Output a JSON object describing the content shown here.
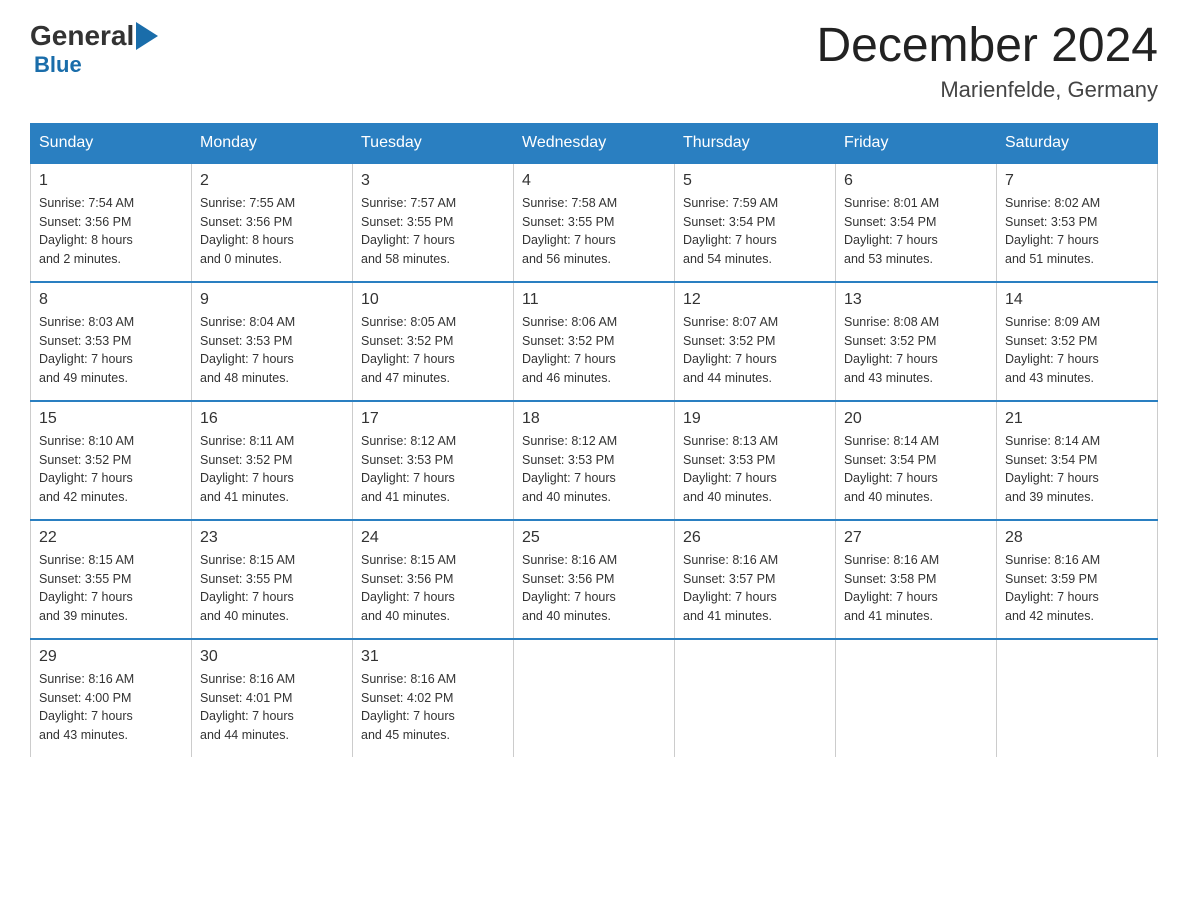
{
  "logo": {
    "general": "General",
    "arrow": "▶",
    "blue": "Blue"
  },
  "title": "December 2024",
  "location": "Marienfelde, Germany",
  "days_header": [
    "Sunday",
    "Monday",
    "Tuesday",
    "Wednesday",
    "Thursday",
    "Friday",
    "Saturday"
  ],
  "weeks": [
    [
      {
        "day": "1",
        "info": "Sunrise: 7:54 AM\nSunset: 3:56 PM\nDaylight: 8 hours\nand 2 minutes."
      },
      {
        "day": "2",
        "info": "Sunrise: 7:55 AM\nSunset: 3:56 PM\nDaylight: 8 hours\nand 0 minutes."
      },
      {
        "day": "3",
        "info": "Sunrise: 7:57 AM\nSunset: 3:55 PM\nDaylight: 7 hours\nand 58 minutes."
      },
      {
        "day": "4",
        "info": "Sunrise: 7:58 AM\nSunset: 3:55 PM\nDaylight: 7 hours\nand 56 minutes."
      },
      {
        "day": "5",
        "info": "Sunrise: 7:59 AM\nSunset: 3:54 PM\nDaylight: 7 hours\nand 54 minutes."
      },
      {
        "day": "6",
        "info": "Sunrise: 8:01 AM\nSunset: 3:54 PM\nDaylight: 7 hours\nand 53 minutes."
      },
      {
        "day": "7",
        "info": "Sunrise: 8:02 AM\nSunset: 3:53 PM\nDaylight: 7 hours\nand 51 minutes."
      }
    ],
    [
      {
        "day": "8",
        "info": "Sunrise: 8:03 AM\nSunset: 3:53 PM\nDaylight: 7 hours\nand 49 minutes."
      },
      {
        "day": "9",
        "info": "Sunrise: 8:04 AM\nSunset: 3:53 PM\nDaylight: 7 hours\nand 48 minutes."
      },
      {
        "day": "10",
        "info": "Sunrise: 8:05 AM\nSunset: 3:52 PM\nDaylight: 7 hours\nand 47 minutes."
      },
      {
        "day": "11",
        "info": "Sunrise: 8:06 AM\nSunset: 3:52 PM\nDaylight: 7 hours\nand 46 minutes."
      },
      {
        "day": "12",
        "info": "Sunrise: 8:07 AM\nSunset: 3:52 PM\nDaylight: 7 hours\nand 44 minutes."
      },
      {
        "day": "13",
        "info": "Sunrise: 8:08 AM\nSunset: 3:52 PM\nDaylight: 7 hours\nand 43 minutes."
      },
      {
        "day": "14",
        "info": "Sunrise: 8:09 AM\nSunset: 3:52 PM\nDaylight: 7 hours\nand 43 minutes."
      }
    ],
    [
      {
        "day": "15",
        "info": "Sunrise: 8:10 AM\nSunset: 3:52 PM\nDaylight: 7 hours\nand 42 minutes."
      },
      {
        "day": "16",
        "info": "Sunrise: 8:11 AM\nSunset: 3:52 PM\nDaylight: 7 hours\nand 41 minutes."
      },
      {
        "day": "17",
        "info": "Sunrise: 8:12 AM\nSunset: 3:53 PM\nDaylight: 7 hours\nand 41 minutes."
      },
      {
        "day": "18",
        "info": "Sunrise: 8:12 AM\nSunset: 3:53 PM\nDaylight: 7 hours\nand 40 minutes."
      },
      {
        "day": "19",
        "info": "Sunrise: 8:13 AM\nSunset: 3:53 PM\nDaylight: 7 hours\nand 40 minutes."
      },
      {
        "day": "20",
        "info": "Sunrise: 8:14 AM\nSunset: 3:54 PM\nDaylight: 7 hours\nand 40 minutes."
      },
      {
        "day": "21",
        "info": "Sunrise: 8:14 AM\nSunset: 3:54 PM\nDaylight: 7 hours\nand 39 minutes."
      }
    ],
    [
      {
        "day": "22",
        "info": "Sunrise: 8:15 AM\nSunset: 3:55 PM\nDaylight: 7 hours\nand 39 minutes."
      },
      {
        "day": "23",
        "info": "Sunrise: 8:15 AM\nSunset: 3:55 PM\nDaylight: 7 hours\nand 40 minutes."
      },
      {
        "day": "24",
        "info": "Sunrise: 8:15 AM\nSunset: 3:56 PM\nDaylight: 7 hours\nand 40 minutes."
      },
      {
        "day": "25",
        "info": "Sunrise: 8:16 AM\nSunset: 3:56 PM\nDaylight: 7 hours\nand 40 minutes."
      },
      {
        "day": "26",
        "info": "Sunrise: 8:16 AM\nSunset: 3:57 PM\nDaylight: 7 hours\nand 41 minutes."
      },
      {
        "day": "27",
        "info": "Sunrise: 8:16 AM\nSunset: 3:58 PM\nDaylight: 7 hours\nand 41 minutes."
      },
      {
        "day": "28",
        "info": "Sunrise: 8:16 AM\nSunset: 3:59 PM\nDaylight: 7 hours\nand 42 minutes."
      }
    ],
    [
      {
        "day": "29",
        "info": "Sunrise: 8:16 AM\nSunset: 4:00 PM\nDaylight: 7 hours\nand 43 minutes."
      },
      {
        "day": "30",
        "info": "Sunrise: 8:16 AM\nSunset: 4:01 PM\nDaylight: 7 hours\nand 44 minutes."
      },
      {
        "day": "31",
        "info": "Sunrise: 8:16 AM\nSunset: 4:02 PM\nDaylight: 7 hours\nand 45 minutes."
      },
      {
        "day": "",
        "info": ""
      },
      {
        "day": "",
        "info": ""
      },
      {
        "day": "",
        "info": ""
      },
      {
        "day": "",
        "info": ""
      }
    ]
  ]
}
